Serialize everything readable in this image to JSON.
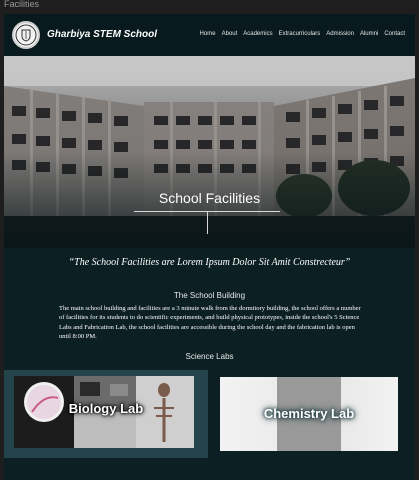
{
  "window": {
    "title": "Facilities"
  },
  "nav": {
    "brand": "Gharbiya STEM School",
    "items": [
      "Home",
      "About",
      "Academics",
      "Extracurriculars",
      "Admission",
      "Alumni",
      "Contact"
    ]
  },
  "hero": {
    "title": "School Facilities"
  },
  "quote": "“The School Facilities are Lorem Ipsum Dolor Sit Amit Constrecteur”",
  "building": {
    "heading": "The School Building",
    "text": "The main school building and facilities are a 3 minute walk from the dormitory building, the school offers a number of facilities for its students to do scientific experiments, and build physical prototypes, inside the school's 5 Science Labs and Fabrication Lab, the school facilities are accessible during the school day and the fabrication lab is open until 8:00 PM."
  },
  "labs": {
    "heading": "Science Labs",
    "biology": "Biology Lab",
    "chemistry": "Chemistry Lab"
  },
  "icons": {
    "logo": "school-crest-icon"
  },
  "colors": {
    "page_bg": "#0c2024",
    "nav_bg": "#081a1d",
    "bio_card": "#24444b"
  }
}
